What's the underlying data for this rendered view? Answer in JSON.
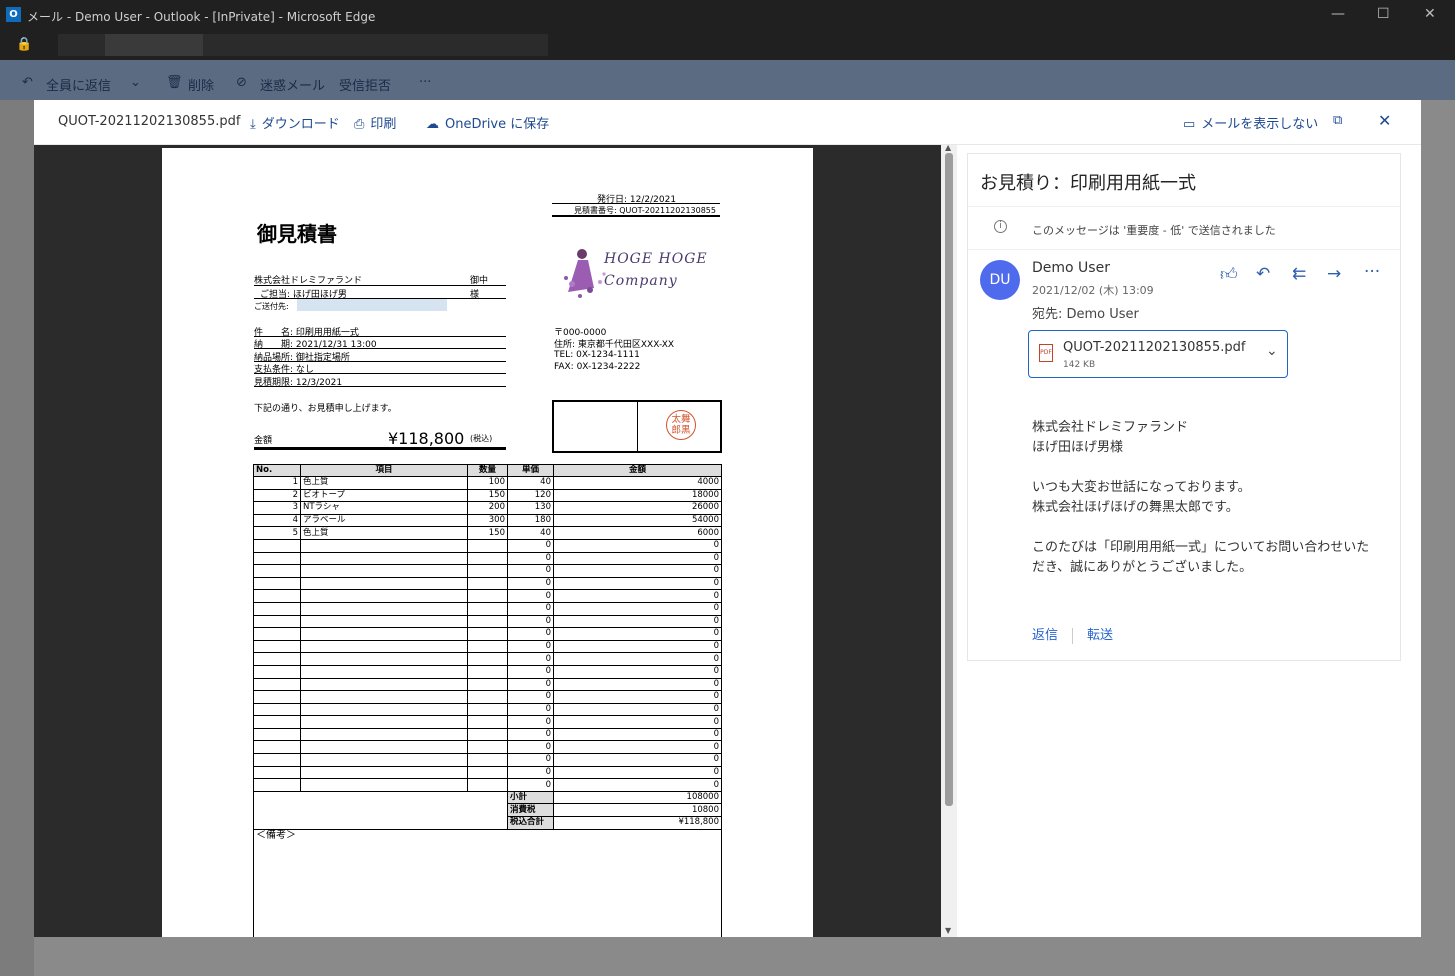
{
  "window": {
    "title": "メール - Demo User - Outlook - [InPrivate] - Microsoft Edge",
    "minimize": "—",
    "maximize": "☐",
    "close": "✕"
  },
  "bg_toolbar": {
    "reply_all": "全員に返信",
    "delete": "削除",
    "junk": "迷惑メール",
    "block": "受信拒否",
    "more": "···"
  },
  "viewer_bar": {
    "filename": "QUOT-20211202130855.pdf",
    "download": "ダウンロード",
    "print": "印刷",
    "onedrive": "OneDrive に保存",
    "hide_mail": "メールを表示しない",
    "popout_icon": "popout-icon",
    "close_icon": "close-icon"
  },
  "doc": {
    "issue_date": "発行日: 12/2/2021",
    "quote_no": "見積書番号: QUOT-20211202130855",
    "title": "御見積書",
    "client": "株式会社ドレミファランド",
    "client_suffix": "御中",
    "contact": "ご担当: ほげ田ほげ男",
    "contact_suffix": "様",
    "send_to": "ご送付先:",
    "subject": "件　　名: 印刷用用紙一式",
    "delivery": "納　　期: 2021/12/31 13:00",
    "place": "納品場所: 御社指定場所",
    "payment": "支払条件: なし",
    "expiry": "見積期限: 12/3/2021",
    "company_logo_text": "HOGE HOGE Company",
    "postal": "〒000-0000",
    "address": "住所: 東京都千代田区XXX-XX",
    "tel": "TEL: 0X-1234-1111",
    "fax": "FAX: 0X-1234-2222",
    "intro": "下記の通り、お見積申し上げます。",
    "amount_label": "金額",
    "amount": "¥118,800",
    "tax_note": "(税込)",
    "stamp": "太舞郎黒",
    "table_headers": [
      "No.",
      "項目",
      "数量",
      "単価",
      "金額"
    ],
    "items": [
      [
        "1",
        "色上質",
        "100",
        "40",
        "4000"
      ],
      [
        "2",
        "ビオトープ",
        "150",
        "120",
        "18000"
      ],
      [
        "3",
        "NTラシャ",
        "200",
        "130",
        "26000"
      ],
      [
        "4",
        "アラベール",
        "300",
        "180",
        "54000"
      ],
      [
        "5",
        "色上質",
        "150",
        "40",
        "6000"
      ]
    ],
    "empty_rows": 20,
    "empty_val": "0",
    "subtotal_label": "小計",
    "subtotal": "108000",
    "tax_label": "消費税",
    "tax": "10800",
    "total_label": "税込合計",
    "total": "¥118,800",
    "remarks": "＜備考＞"
  },
  "mail": {
    "subject": "お見積り：印刷用用紙一式",
    "importance": "このメッセージは '重要度 - 低' で送信されました",
    "avatar": "DU",
    "sender": "Demo User",
    "date": "2021/12/02 (木) 13:09",
    "to": "宛先:  Demo User",
    "attachment_name": "QUOT-20211202130855.pdf",
    "attachment_size": "142 KB",
    "body": [
      "株式会社ドレミファランド",
      "ほげ田ほげ男様",
      "",
      "いつも大変お世話になっております。",
      "株式会社ほげほげの舞黒太郎です。",
      "",
      "このたびは「印刷用用紙一式」についてお問い合わせいた",
      "だき、誠にありがとうございました。"
    ],
    "reply": "返信",
    "forward": "転送"
  }
}
